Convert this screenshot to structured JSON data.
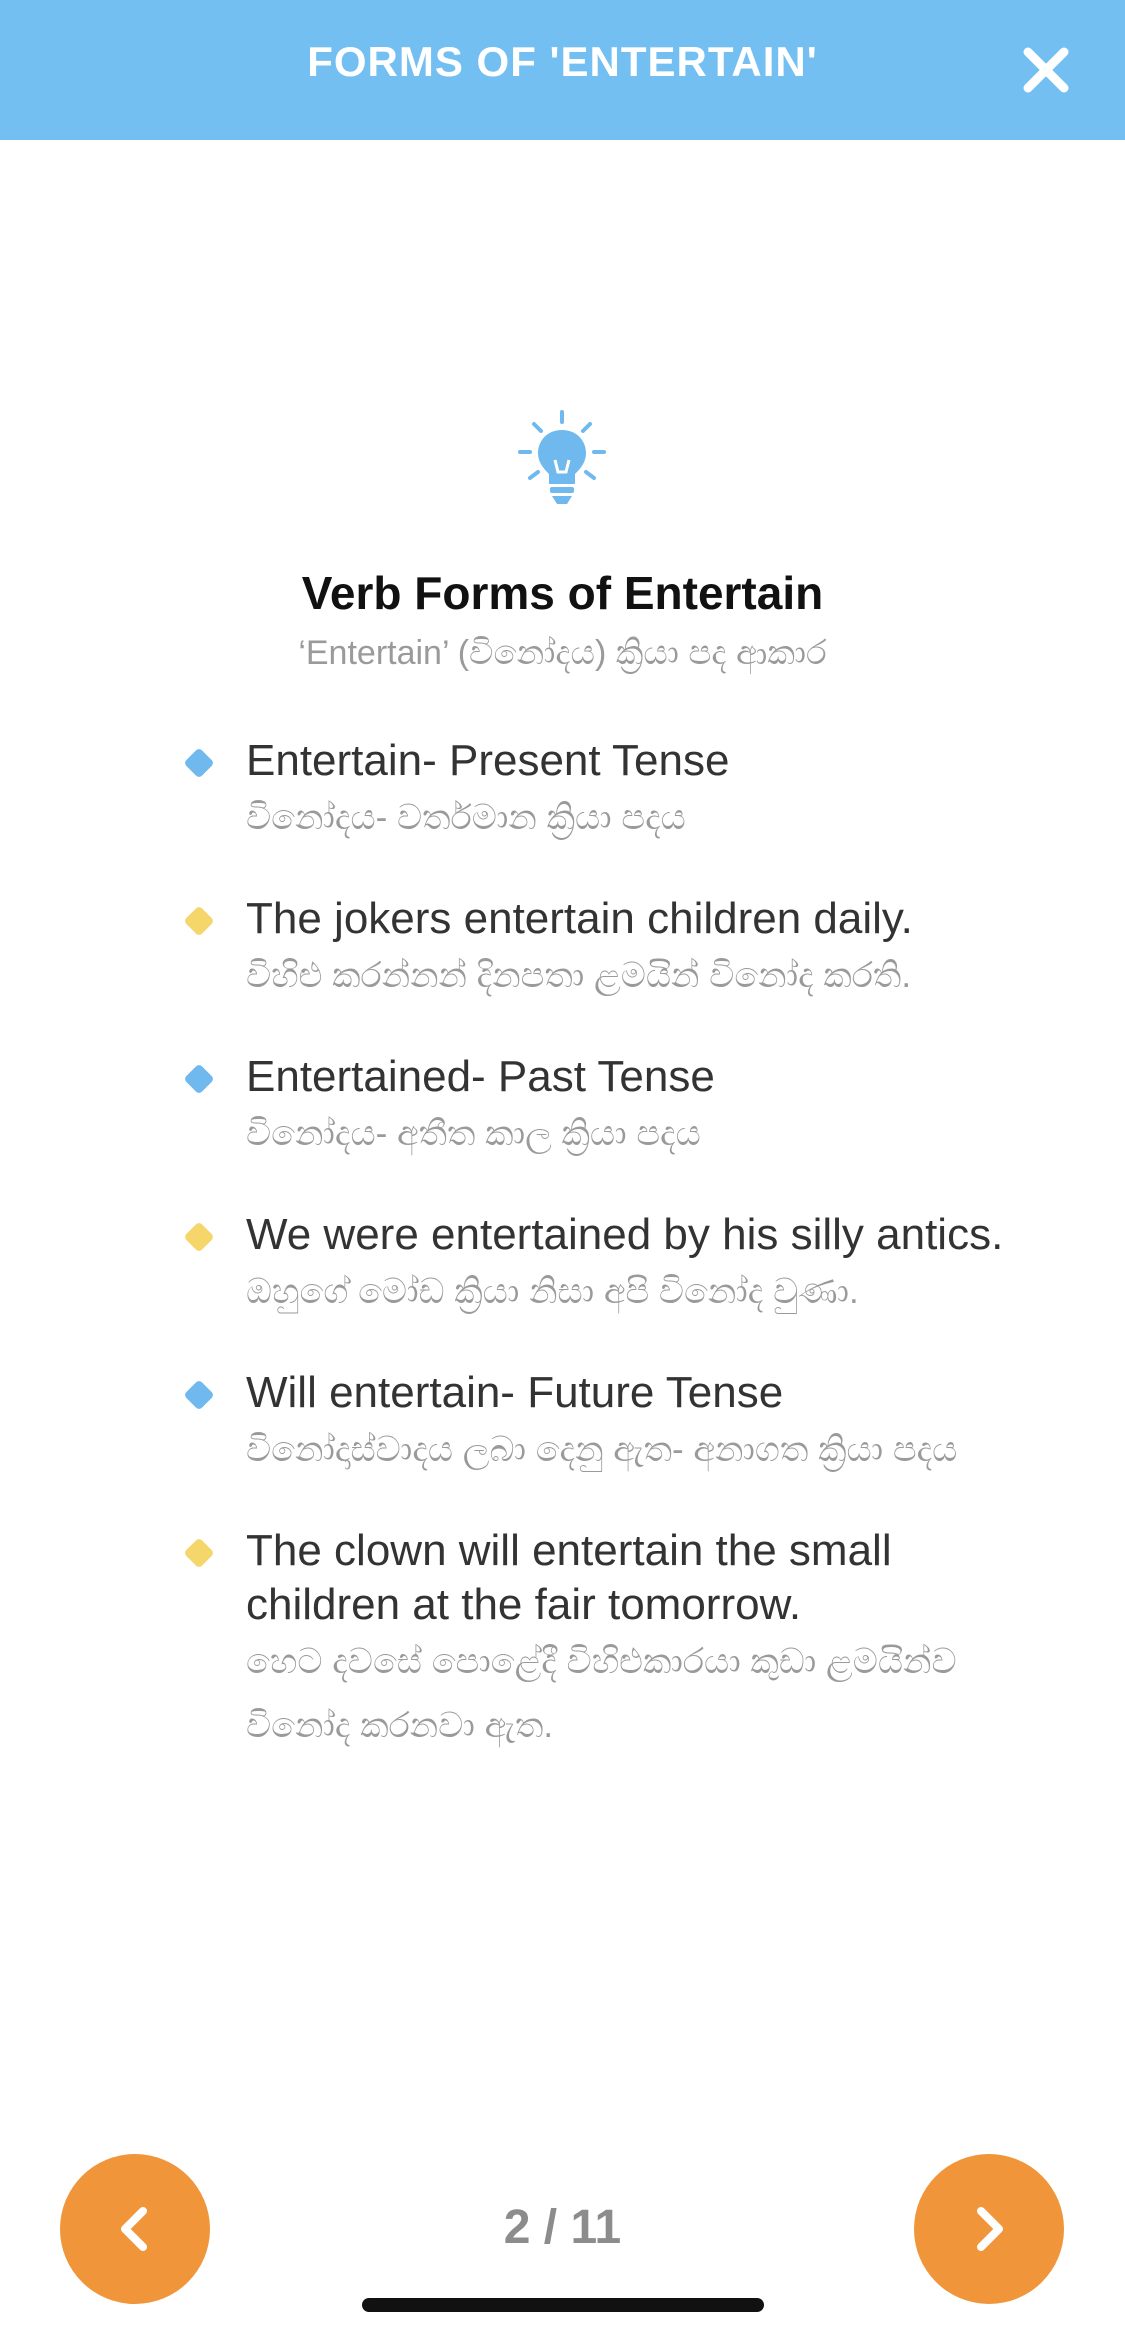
{
  "header": {
    "title": "FORMS OF 'ENTERTAIN'",
    "close_icon": "close-icon"
  },
  "colors": {
    "header_bg": "#73bff2",
    "accent_blue": "#6fb9ee",
    "accent_yellow": "#f5d66a",
    "nav_button": "#f0953a"
  },
  "content": {
    "icon": "lightbulb-icon",
    "title": "Verb Forms of Entertain",
    "subtitle": "‘Entertain’ (විනෝදය) ක්‍රියා පද ආකාර",
    "items": [
      {
        "color": "blue",
        "en": "Entertain- Present Tense",
        "si": "විනෝදය- වර්තමාන ක්‍රියා පදය"
      },
      {
        "color": "yellow",
        "en": "The jokers entertain children daily.",
        "si": "විහිළු කරන්නන් දිනපතා ළමයින් විනෝද කරති."
      },
      {
        "color": "blue",
        "en": "Entertained- Past Tense",
        "si": "විනෝදය- අතීත කාල ක්‍රියා පදය"
      },
      {
        "color": "yellow",
        "en": "We were entertained by his silly antics.",
        "si": "ඔහුගේ මෝඩ ක්‍රියා නිසා අපි විනෝද වුණා."
      },
      {
        "color": "blue",
        "en": "Will entertain- Future Tense",
        "si": "විනෝදාස්වාදය ලබා දෙනු ඇත- අනාගත ක්‍රියා පදය"
      },
      {
        "color": "yellow",
        "en": "The clown will entertain the small children at the fair tomorrow.",
        "si": "හෙට දවසේ පොළේදී විහිළුකාරයා කුඩා ළමයින්ව විනෝද කරනවා ඇත."
      }
    ]
  },
  "footer": {
    "prev_icon": "chevron-left-icon",
    "next_icon": "chevron-right-icon",
    "page_indicator": "2 / 11"
  }
}
